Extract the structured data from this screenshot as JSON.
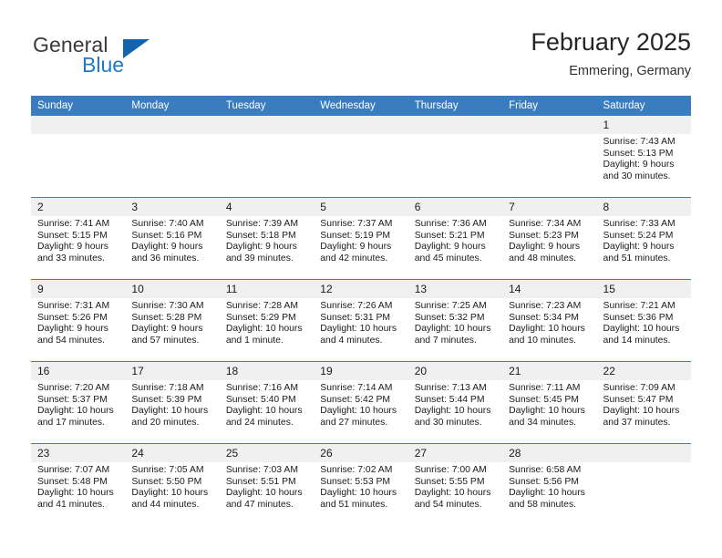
{
  "brand": {
    "name_part1": "General",
    "name_part2": "Blue",
    "logo_icon": "triangle-icon"
  },
  "header": {
    "title": "February 2025",
    "subtitle": "Emmering, Germany"
  },
  "colors": {
    "header_blue": "#3a7dbf",
    "logo_blue": "#1164ad",
    "text_blue": "#1f7ac4",
    "daynum_bg": "#f0f0f0"
  },
  "weekdays": [
    "Sunday",
    "Monday",
    "Tuesday",
    "Wednesday",
    "Thursday",
    "Friday",
    "Saturday"
  ],
  "labels": {
    "sunrise": "Sunrise:",
    "sunset": "Sunset:",
    "daylight": "Daylight:"
  },
  "weeks": [
    [
      {
        "day": "",
        "blank": true
      },
      {
        "day": "",
        "blank": true
      },
      {
        "day": "",
        "blank": true
      },
      {
        "day": "",
        "blank": true
      },
      {
        "day": "",
        "blank": true
      },
      {
        "day": "",
        "blank": true
      },
      {
        "day": "1",
        "sunrise": "Sunrise: 7:43 AM",
        "sunset": "Sunset: 5:13 PM",
        "daylight1": "Daylight: 9 hours",
        "daylight2": "and 30 minutes."
      }
    ],
    [
      {
        "day": "2",
        "sunrise": "Sunrise: 7:41 AM",
        "sunset": "Sunset: 5:15 PM",
        "daylight1": "Daylight: 9 hours",
        "daylight2": "and 33 minutes."
      },
      {
        "day": "3",
        "sunrise": "Sunrise: 7:40 AM",
        "sunset": "Sunset: 5:16 PM",
        "daylight1": "Daylight: 9 hours",
        "daylight2": "and 36 minutes."
      },
      {
        "day": "4",
        "sunrise": "Sunrise: 7:39 AM",
        "sunset": "Sunset: 5:18 PM",
        "daylight1": "Daylight: 9 hours",
        "daylight2": "and 39 minutes."
      },
      {
        "day": "5",
        "sunrise": "Sunrise: 7:37 AM",
        "sunset": "Sunset: 5:19 PM",
        "daylight1": "Daylight: 9 hours",
        "daylight2": "and 42 minutes."
      },
      {
        "day": "6",
        "sunrise": "Sunrise: 7:36 AM",
        "sunset": "Sunset: 5:21 PM",
        "daylight1": "Daylight: 9 hours",
        "daylight2": "and 45 minutes."
      },
      {
        "day": "7",
        "sunrise": "Sunrise: 7:34 AM",
        "sunset": "Sunset: 5:23 PM",
        "daylight1": "Daylight: 9 hours",
        "daylight2": "and 48 minutes."
      },
      {
        "day": "8",
        "sunrise": "Sunrise: 7:33 AM",
        "sunset": "Sunset: 5:24 PM",
        "daylight1": "Daylight: 9 hours",
        "daylight2": "and 51 minutes."
      }
    ],
    [
      {
        "day": "9",
        "sunrise": "Sunrise: 7:31 AM",
        "sunset": "Sunset: 5:26 PM",
        "daylight1": "Daylight: 9 hours",
        "daylight2": "and 54 minutes."
      },
      {
        "day": "10",
        "sunrise": "Sunrise: 7:30 AM",
        "sunset": "Sunset: 5:28 PM",
        "daylight1": "Daylight: 9 hours",
        "daylight2": "and 57 minutes."
      },
      {
        "day": "11",
        "sunrise": "Sunrise: 7:28 AM",
        "sunset": "Sunset: 5:29 PM",
        "daylight1": "Daylight: 10 hours",
        "daylight2": "and 1 minute."
      },
      {
        "day": "12",
        "sunrise": "Sunrise: 7:26 AM",
        "sunset": "Sunset: 5:31 PM",
        "daylight1": "Daylight: 10 hours",
        "daylight2": "and 4 minutes."
      },
      {
        "day": "13",
        "sunrise": "Sunrise: 7:25 AM",
        "sunset": "Sunset: 5:32 PM",
        "daylight1": "Daylight: 10 hours",
        "daylight2": "and 7 minutes."
      },
      {
        "day": "14",
        "sunrise": "Sunrise: 7:23 AM",
        "sunset": "Sunset: 5:34 PM",
        "daylight1": "Daylight: 10 hours",
        "daylight2": "and 10 minutes."
      },
      {
        "day": "15",
        "sunrise": "Sunrise: 7:21 AM",
        "sunset": "Sunset: 5:36 PM",
        "daylight1": "Daylight: 10 hours",
        "daylight2": "and 14 minutes."
      }
    ],
    [
      {
        "day": "16",
        "sunrise": "Sunrise: 7:20 AM",
        "sunset": "Sunset: 5:37 PM",
        "daylight1": "Daylight: 10 hours",
        "daylight2": "and 17 minutes."
      },
      {
        "day": "17",
        "sunrise": "Sunrise: 7:18 AM",
        "sunset": "Sunset: 5:39 PM",
        "daylight1": "Daylight: 10 hours",
        "daylight2": "and 20 minutes."
      },
      {
        "day": "18",
        "sunrise": "Sunrise: 7:16 AM",
        "sunset": "Sunset: 5:40 PM",
        "daylight1": "Daylight: 10 hours",
        "daylight2": "and 24 minutes."
      },
      {
        "day": "19",
        "sunrise": "Sunrise: 7:14 AM",
        "sunset": "Sunset: 5:42 PM",
        "daylight1": "Daylight: 10 hours",
        "daylight2": "and 27 minutes."
      },
      {
        "day": "20",
        "sunrise": "Sunrise: 7:13 AM",
        "sunset": "Sunset: 5:44 PM",
        "daylight1": "Daylight: 10 hours",
        "daylight2": "and 30 minutes."
      },
      {
        "day": "21",
        "sunrise": "Sunrise: 7:11 AM",
        "sunset": "Sunset: 5:45 PM",
        "daylight1": "Daylight: 10 hours",
        "daylight2": "and 34 minutes."
      },
      {
        "day": "22",
        "sunrise": "Sunrise: 7:09 AM",
        "sunset": "Sunset: 5:47 PM",
        "daylight1": "Daylight: 10 hours",
        "daylight2": "and 37 minutes."
      }
    ],
    [
      {
        "day": "23",
        "sunrise": "Sunrise: 7:07 AM",
        "sunset": "Sunset: 5:48 PM",
        "daylight1": "Daylight: 10 hours",
        "daylight2": "and 41 minutes."
      },
      {
        "day": "24",
        "sunrise": "Sunrise: 7:05 AM",
        "sunset": "Sunset: 5:50 PM",
        "daylight1": "Daylight: 10 hours",
        "daylight2": "and 44 minutes."
      },
      {
        "day": "25",
        "sunrise": "Sunrise: 7:03 AM",
        "sunset": "Sunset: 5:51 PM",
        "daylight1": "Daylight: 10 hours",
        "daylight2": "and 47 minutes."
      },
      {
        "day": "26",
        "sunrise": "Sunrise: 7:02 AM",
        "sunset": "Sunset: 5:53 PM",
        "daylight1": "Daylight: 10 hours",
        "daylight2": "and 51 minutes."
      },
      {
        "day": "27",
        "sunrise": "Sunrise: 7:00 AM",
        "sunset": "Sunset: 5:55 PM",
        "daylight1": "Daylight: 10 hours",
        "daylight2": "and 54 minutes."
      },
      {
        "day": "28",
        "sunrise": "Sunrise: 6:58 AM",
        "sunset": "Sunset: 5:56 PM",
        "daylight1": "Daylight: 10 hours",
        "daylight2": "and 58 minutes."
      },
      {
        "day": "",
        "blank": true
      }
    ]
  ]
}
